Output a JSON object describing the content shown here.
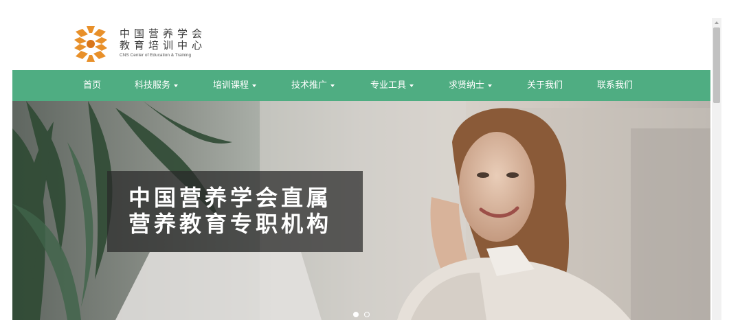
{
  "brand": {
    "line1": "中国营养学会",
    "line2": "教育培训中心",
    "line3": "CNS Center of Education & Training",
    "logo_icon": "cns-sunburst-logo-icon",
    "colors": {
      "orange": "#e8902a",
      "orange_dark": "#d9761a"
    }
  },
  "nav": {
    "background": "#4fad82",
    "items": [
      {
        "label": "首页",
        "has_dropdown": false
      },
      {
        "label": "科技服务",
        "has_dropdown": true
      },
      {
        "label": "培训课程",
        "has_dropdown": true
      },
      {
        "label": "技术推广",
        "has_dropdown": true
      },
      {
        "label": "专业工具",
        "has_dropdown": true
      },
      {
        "label": "求贤纳士",
        "has_dropdown": true
      },
      {
        "label": "关于我们",
        "has_dropdown": false
      },
      {
        "label": "联系我们",
        "has_dropdown": false
      }
    ]
  },
  "hero": {
    "caption_line1": "中国营养学会直属",
    "caption_line2": "营养教育专职机构",
    "slides_total": 2,
    "active_slide": 1
  }
}
